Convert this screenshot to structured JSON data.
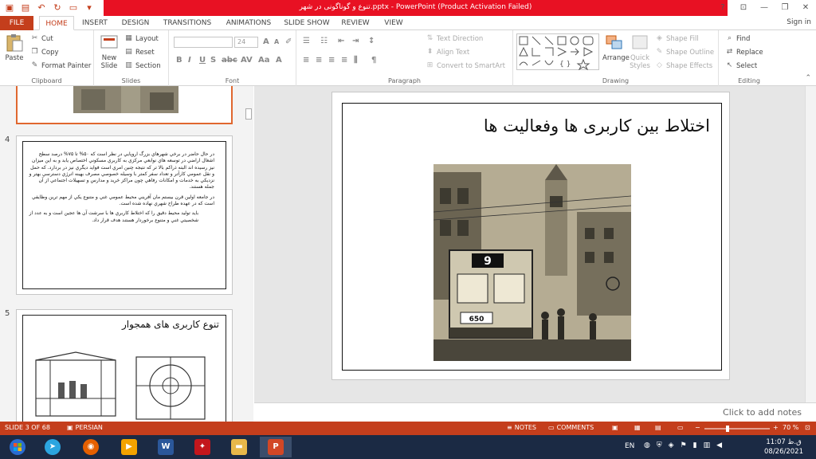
{
  "titlebar": {
    "title": "تنوع و گوناگونی در شهر.pptx - PowerPoint (Product Activation Failed)",
    "help": "?",
    "minimize": "—",
    "restore": "❐",
    "close": "✕"
  },
  "tabs": [
    "FILE",
    "HOME",
    "INSERT",
    "DESIGN",
    "TRANSITIONS",
    "ANIMATIONS",
    "SLIDE SHOW",
    "REVIEW",
    "VIEW"
  ],
  "signin": "Sign in",
  "ribbon": {
    "clipboard": {
      "label": "Clipboard",
      "paste": "Paste",
      "cut": "Cut",
      "copy": "Copy",
      "format_painter": "Format Painter"
    },
    "slides": {
      "label": "Slides",
      "new_slide": "New",
      "new_slide2": "Slide",
      "layout": "Layout",
      "reset": "Reset",
      "section": "Section"
    },
    "font": {
      "label": "Font",
      "size": "24"
    },
    "paragraph": {
      "label": "Paragraph",
      "text_direction": "Text Direction",
      "align_text": "Align Text",
      "convert_smartart": "Convert to SmartArt"
    },
    "drawing": {
      "label": "Drawing",
      "arrange": "Arrange",
      "quick_styles": "Quick",
      "quick_styles2": "Styles",
      "shape_fill": "Shape Fill",
      "shape_outline": "Shape Outline",
      "shape_effects": "Shape Effects"
    },
    "editing": {
      "label": "Editing",
      "find": "Find",
      "replace": "Replace",
      "select": "Select"
    }
  },
  "thumbnails": {
    "slide4_number": "4",
    "slide4_bullets": [
      "در حال حاضر در برخي شهرهاي بزرگ اروپايي در نظر است كه ۵۰% تا ۷۵% درصد سطح اشغال اراضي در توسعه هاي نوابعي مركزي به كاربري مسكوني اختصاص يابد و به اين ميزان نيز رسيده اند البته ذراكم بالا تر كه نتيجه چنين امري است فوايد ديگري نيز در بردارد. كه حمل و نقل عمومي كارآتر و تعداد سفر كمتر با وسيله خصوصي مصرف بهينه انرژي دسترسي بهتر و نزديكي به خدمات و امكانات رفاهي چون مراكز خريد و مدارس و تسهيلات اجتماعي از آن جمله هستند.",
      "در جامعه اولين قرن بيستم مان آفريني محيط عمومي غني و متنوع يكي از مهم ترين وظايفي است كه در عهده طراح شهري نهاده شده است."
    ],
    "slide4_para": "بايد توليد محيط دقيق را كه اختلاط كاربري ها با سرشت آن ها عجين است و به عدد از شخصيتي غني و متنوع برخوردار هستند هدف قرار داد.",
    "slide5_number": "5",
    "slide5_title": "تنوع کاربری های همجوار"
  },
  "slide": {
    "heading": "اختلاط بین کاربری ها وفعالیت ها",
    "tram_number": "9",
    "tram_plate": "650"
  },
  "notes_placeholder": "Click to add notes",
  "statusbar": {
    "slide_of": "SLIDE 3 OF 68",
    "language": "PERSIAN",
    "notes": "NOTES",
    "comments": "COMMENTS",
    "zoom": "70 %"
  },
  "tray": {
    "lang": "EN",
    "time": "11:07 ق.ظ",
    "date": "08/26/2021"
  },
  "colors": {
    "accent": "#c43e1c",
    "title_strip": "#e81123",
    "taskbar": "#1b2a44"
  }
}
